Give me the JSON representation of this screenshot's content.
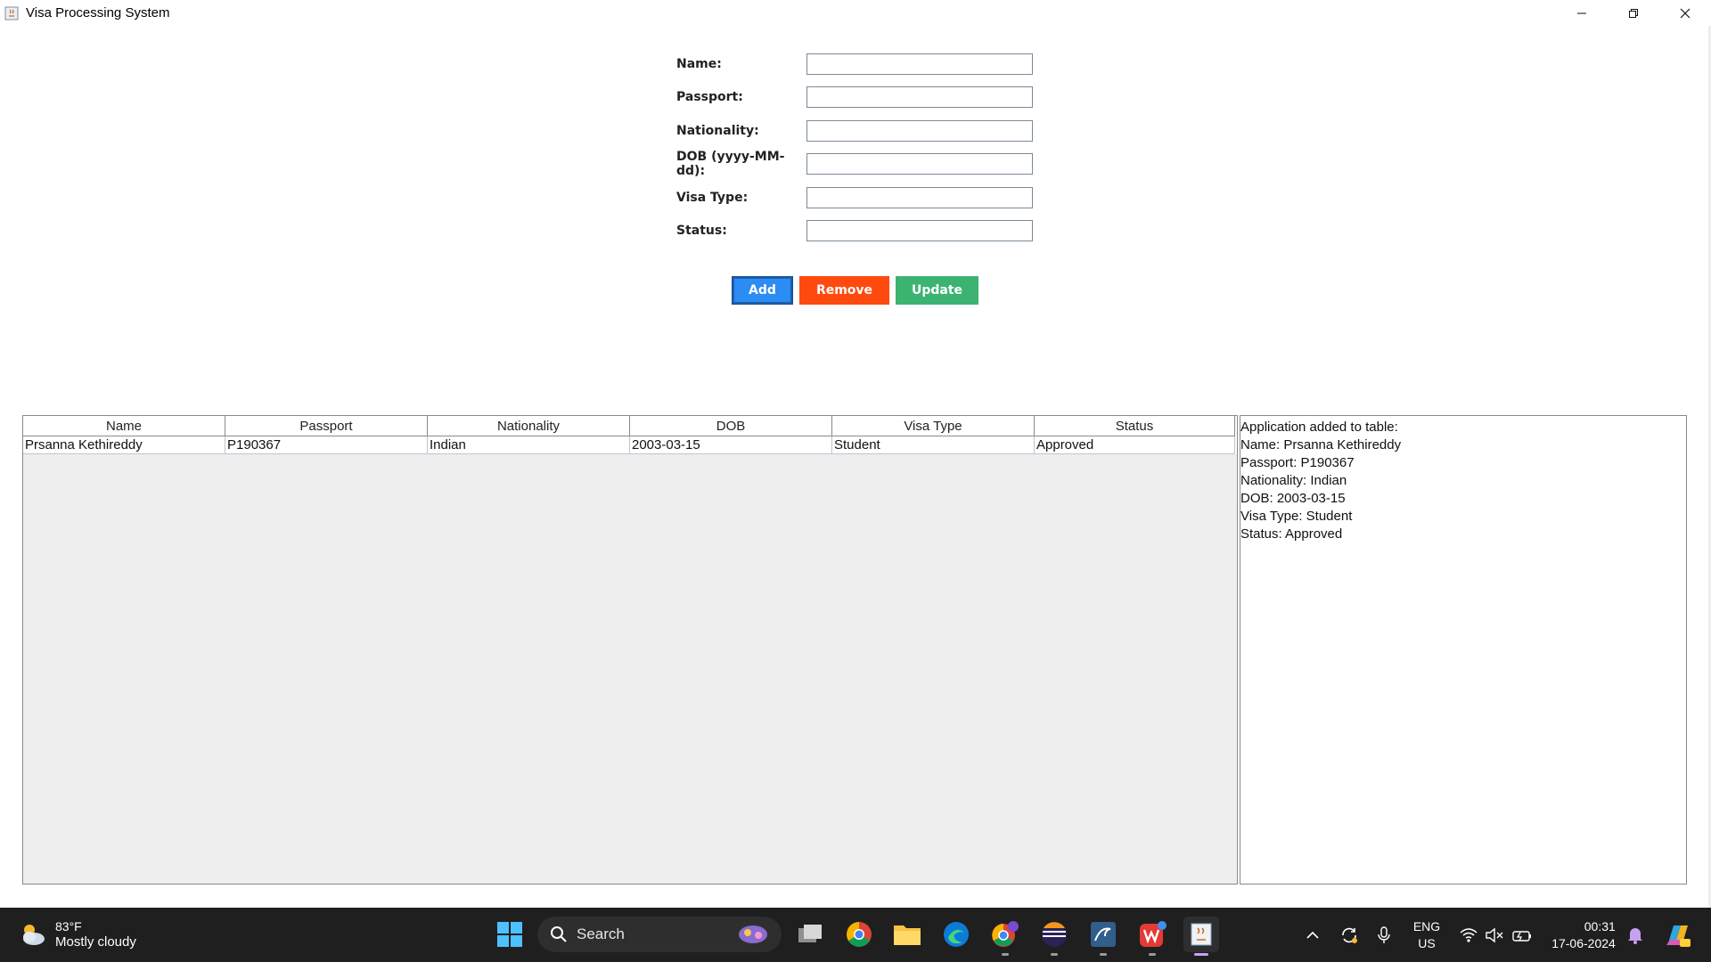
{
  "window": {
    "title": "Visa Processing System"
  },
  "form": {
    "fields": [
      {
        "label": "Name:",
        "value": ""
      },
      {
        "label": "Passport:",
        "value": ""
      },
      {
        "label": "Nationality:",
        "value": ""
      },
      {
        "label": "DOB (yyyy-MM-dd):",
        "value": ""
      },
      {
        "label": "Visa Type:",
        "value": ""
      },
      {
        "label": "Status:",
        "value": ""
      }
    ],
    "buttons": {
      "add": "Add",
      "remove": "Remove",
      "update": "Update"
    },
    "colors": {
      "add": "#2b8cf3",
      "remove": "#ff4a0f",
      "update": "#3cb371"
    }
  },
  "table": {
    "columns": [
      "Name",
      "Passport",
      "Nationality",
      "DOB",
      "Visa Type",
      "Status"
    ],
    "rows": [
      [
        "Prsanna Kethireddy",
        "P190367",
        "Indian",
        "2003-03-15",
        "Student",
        "Approved"
      ]
    ]
  },
  "log": {
    "lines": [
      "Application added to table:",
      "Name: Prsanna Kethireddy",
      "Passport: P190367",
      "Nationality: Indian",
      "DOB: 2003-03-15",
      "Visa Type: Student",
      "Status: Approved"
    ]
  },
  "taskbar": {
    "weather": {
      "temp": "83°F",
      "desc": "Mostly cloudy"
    },
    "search_label": "Search",
    "lang": {
      "line1": "ENG",
      "line2": "US"
    },
    "clock": {
      "time": "00:31",
      "date": "17-06-2024"
    }
  }
}
